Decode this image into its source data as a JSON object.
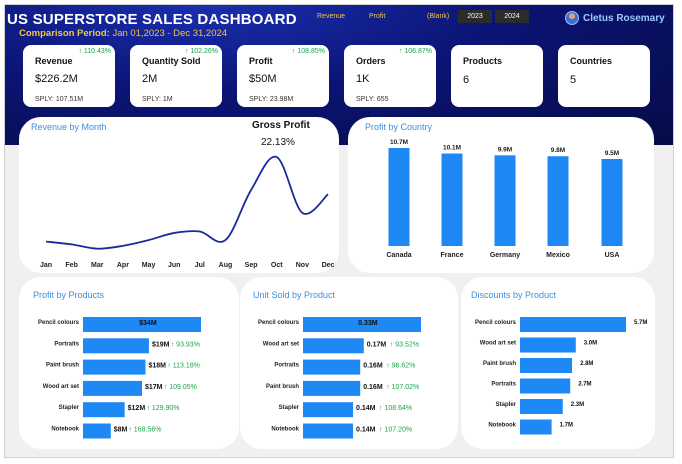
{
  "header": {
    "title": "US SUPERSTORE SALES DASHBOARD",
    "period_label": "Comparison Period:",
    "period_value": "Jan 01,2023 - Dec 31,2024",
    "slicers": [
      "Revenue",
      "Profit",
      "(Blank)"
    ],
    "years": [
      "2023",
      "2024"
    ],
    "user_name": "Cletus Rosemary"
  },
  "kpis": [
    {
      "label": "Revenue",
      "value": "$226.2M",
      "delta": "↑ 110.43%",
      "sply": "SPLY: 107.51M"
    },
    {
      "label": "Quantity Sold",
      "value": "2M",
      "delta": "↑ 102.26%",
      "sply": "SPLY: 1M"
    },
    {
      "label": "Profit",
      "value": "$50M",
      "delta": "↑ 108.85%",
      "sply": "SPLY: 23.98M"
    },
    {
      "label": "Orders",
      "value": "1K",
      "delta": "↑ 106.87%",
      "sply": "SPLY: 655"
    },
    {
      "label": "Products",
      "value": "6"
    },
    {
      "label": "Countries",
      "value": "5"
    }
  ],
  "revenue_card": {
    "title": "Revenue by Month",
    "gp_title": "Gross Profit",
    "gp_value": "22.13%"
  },
  "country_card": {
    "title": "Profit by Country"
  },
  "products_card": {
    "title": "Profit by Products"
  },
  "units_card": {
    "title": "Unit Sold by Product"
  },
  "discount_card": {
    "title": "Discounts by Product"
  },
  "colors": {
    "bar": "#1e88f5",
    "line": "#1a2a9c",
    "positive": "#1aa34a",
    "accent_title": "#3d8de0",
    "header_bg": "#0b1474"
  },
  "chart_data": [
    {
      "type": "line",
      "title": "Revenue by Month",
      "categories": [
        "Jan",
        "Feb",
        "Mar",
        "Apr",
        "May",
        "Jun",
        "Jul",
        "Aug",
        "Sep",
        "Oct",
        "Nov",
        "Dec"
      ],
      "values": [
        1.0,
        0.0,
        -1.5,
        -0.5,
        1.5,
        4.0,
        4.5,
        1.5,
        19.0,
        30.5,
        11.0,
        17.5
      ],
      "ylim": [
        -3,
        34
      ],
      "grid": false
    },
    {
      "type": "bar",
      "title": "Profit by Country",
      "categories": [
        "Canada",
        "France",
        "Germany",
        "Mexico",
        "USA"
      ],
      "values": [
        10.7,
        10.1,
        9.9,
        9.8,
        9.5
      ],
      "labels": [
        "10.7M",
        "10.1M",
        "9.9M",
        "9.8M",
        "9.5M"
      ],
      "ylim": [
        0,
        10.7
      ]
    },
    {
      "type": "bar",
      "title": "Profit by Products",
      "orientation": "horizontal",
      "categories": [
        "Pencil colours",
        "Portraits",
        "Paint brush",
        "Wood art set",
        "Stapler",
        "Notebook"
      ],
      "values": [
        34,
        19,
        18,
        17,
        12,
        8
      ],
      "labels": [
        "$34M",
        "$19M",
        "$18M",
        "$17M",
        "$12M",
        "$8M"
      ],
      "deltas": [
        "",
        "↑ 93.93%",
        "↑ 113.18%",
        "↑ 109.05%",
        "↑ 129.90%",
        "↑ 168.56%"
      ]
    },
    {
      "type": "bar",
      "title": "Unit Sold by Product",
      "orientation": "horizontal",
      "categories": [
        "Pencil colours",
        "Wood art set",
        "Portraits",
        "Paint brush",
        "Stapler",
        "Notebook"
      ],
      "values": [
        0.33,
        0.17,
        0.16,
        0.16,
        0.14,
        0.14
      ],
      "labels": [
        "0.33M",
        "0.17M",
        "0.16M",
        "0.16M",
        "0.14M",
        "0.14M"
      ],
      "deltas": [
        "",
        "↑ 93.52%",
        "↑ 96.62%",
        "↑ 107.02%",
        "↑ 108.64%",
        "↑ 107.20%"
      ]
    },
    {
      "type": "bar",
      "title": "Discounts by Product",
      "orientation": "horizontal",
      "categories": [
        "Pencil colours",
        "Wood art set",
        "Paint brush",
        "Portraits",
        "Stapler",
        "Notebook"
      ],
      "values": [
        5.7,
        3.0,
        2.8,
        2.7,
        2.3,
        1.7
      ],
      "labels": [
        "5.7M",
        "3.0M",
        "2.8M",
        "2.7M",
        "2.3M",
        "1.7M"
      ]
    }
  ]
}
